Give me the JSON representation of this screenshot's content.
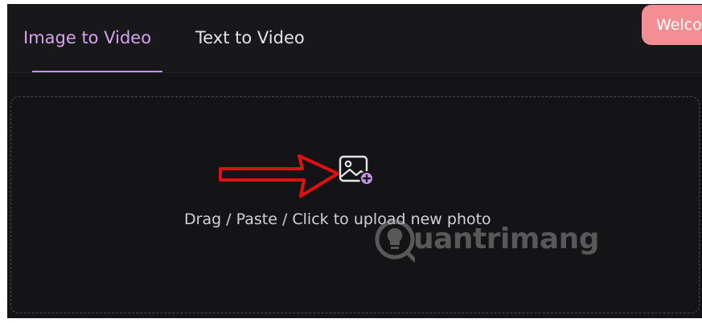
{
  "tabs": [
    {
      "label": "Image to Video",
      "active": true
    },
    {
      "label": "Text to Video",
      "active": false
    }
  ],
  "welcome_button": {
    "label": "Welcome"
  },
  "upload": {
    "instruction": "Drag / Paste / Click to upload new photo",
    "icon": "image-add-icon"
  },
  "watermark": {
    "text": "uantrimang",
    "icon": "lightbulb-logo-icon"
  },
  "colors": {
    "background": "#141416",
    "header": "#18181b",
    "active_tab": "#d7a3f0",
    "accent": "#c590e6",
    "welcome_button": "#f38e94",
    "arrow": "#e01010"
  }
}
